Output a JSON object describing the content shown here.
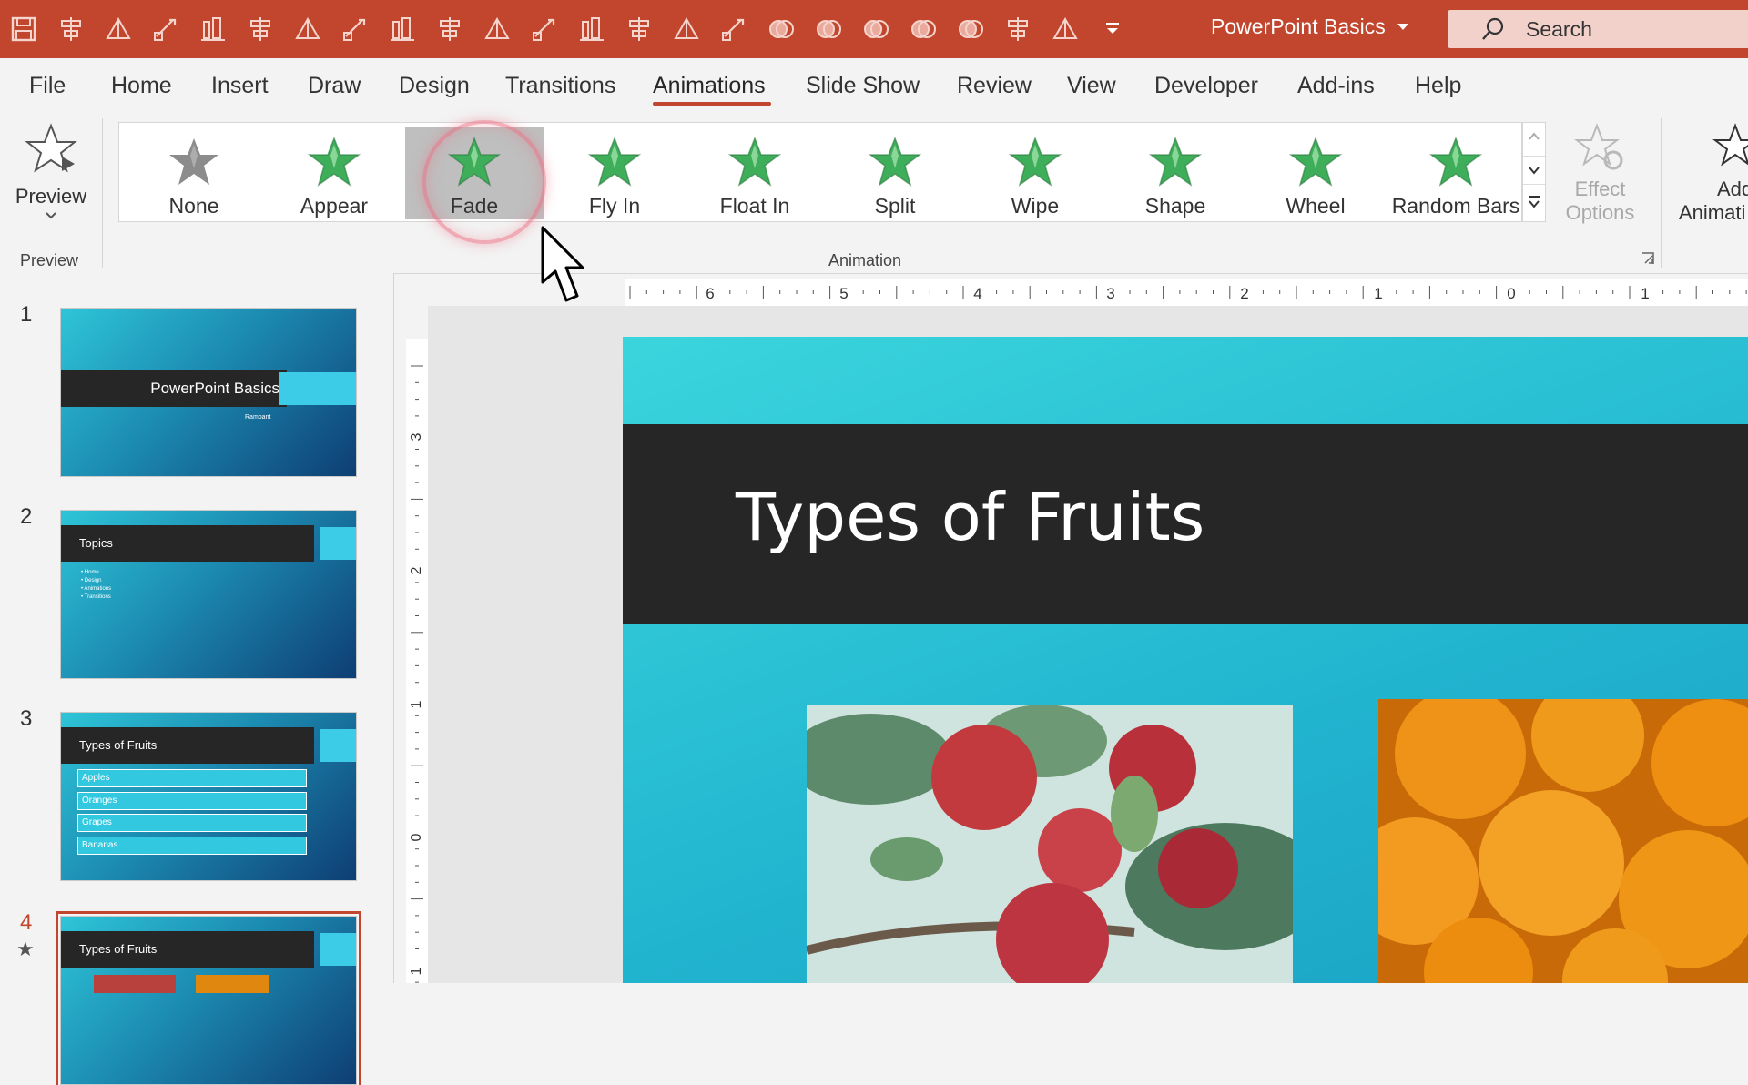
{
  "titlebar": {
    "doc_title": "PowerPoint Basics",
    "search_label": "Search",
    "qat_icons": [
      "save-icon",
      "chart-icon",
      "align-center-icon",
      "align-left-icon",
      "distribute-icon",
      "align-right-icon",
      "align-top-icon",
      "align-middle-icon",
      "distribute-horizontal-icon",
      "triangle-icon",
      "rotate-icon",
      "send-backward-icon",
      "bring-forward-icon",
      "draw-icon",
      "crop-icon",
      "symbol-icon",
      "shape-union-icon",
      "shape-combine-icon",
      "shape-fragment-icon",
      "shape-intersect-icon",
      "shape-subtract-icon",
      "group-icon",
      "present-icon",
      "customize-icon"
    ]
  },
  "tabs": [
    {
      "label": "File"
    },
    {
      "label": "Home"
    },
    {
      "label": "Insert"
    },
    {
      "label": "Draw"
    },
    {
      "label": "Design"
    },
    {
      "label": "Transitions"
    },
    {
      "label": "Animations"
    },
    {
      "label": "Slide Show"
    },
    {
      "label": "Review"
    },
    {
      "label": "View"
    },
    {
      "label": "Developer"
    },
    {
      "label": "Add-ins"
    },
    {
      "label": "Help"
    }
  ],
  "active_tab": "Animations",
  "ribbon": {
    "preview_label": "Preview",
    "preview_group": "Preview",
    "animation_group": "Animation",
    "gallery": [
      {
        "label": "None"
      },
      {
        "label": "Appear"
      },
      {
        "label": "Fade"
      },
      {
        "label": "Fly In"
      },
      {
        "label": "Float In"
      },
      {
        "label": "Split"
      },
      {
        "label": "Wipe"
      },
      {
        "label": "Shape"
      },
      {
        "label": "Wheel"
      },
      {
        "label": "Random Bars"
      }
    ],
    "selected_effect": "Fade",
    "effect_options_line1": "Effect",
    "effect_options_line2": "Options",
    "add_animation_line1": "Add",
    "add_animation_line2": "Animati"
  },
  "slides": [
    {
      "num": "1",
      "title": "PowerPoint Basics",
      "subtitle": "Rampant"
    },
    {
      "num": "2",
      "title": "Topics",
      "bullets": [
        "• Home",
        "• Design",
        "• Animations",
        "• Transitions"
      ]
    },
    {
      "num": "3",
      "title": "Types of Fruits",
      "boxes": [
        "Apples",
        "Oranges",
        "Grapes",
        "Bananas"
      ]
    },
    {
      "num": "4",
      "title": "Types of Fruits",
      "star": "★"
    }
  ],
  "ruler_h_labels": [
    "6",
    "5",
    "4",
    "3",
    "2",
    "1",
    "0",
    "1"
  ],
  "ruler_v_labels": [
    "3",
    "2",
    "1",
    "0",
    "1"
  ],
  "main_slide": {
    "title": "Types of Fruits"
  },
  "colors": {
    "accent": "#c2462d",
    "slide_teal": "#21b4cf",
    "title_band": "#262626"
  }
}
